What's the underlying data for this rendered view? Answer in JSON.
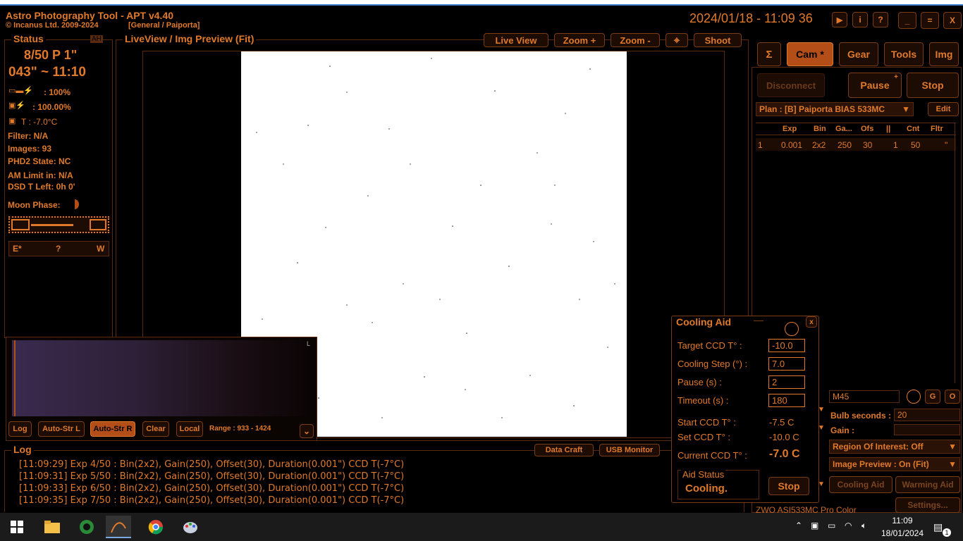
{
  "app": {
    "title": "Astro Photography Tool  -  APT v4.40",
    "copyright": "© Incanus Ltd. 2009-2024",
    "profile": "[General / Paiporta]",
    "datetime": "2024/01/18 - 11:09 36"
  },
  "title_buttons": [
    "▶",
    "i",
    "?",
    "_",
    "=",
    "X"
  ],
  "status": {
    "header": "Status",
    "badge": "AH",
    "line1": "8/50 P   1\"",
    "line2": "043\" ~ 11:10",
    "battery": ": 100%",
    "cam_power": ": 100.00%",
    "temp": "T :  -7.0°C",
    "filter": "Filter: N/A",
    "images": "Images: 93",
    "phd2": "PHD2 State: NC",
    "am_limit": "AM Limit in: N/A",
    "dsd": "DSD T Left: 0h 0'",
    "moon": "Moon Phase:",
    "compass_e": "E*",
    "compass_q": "?",
    "compass_w": "W"
  },
  "liveview": {
    "header": "LiveView / Img Preview (Fit)",
    "buttons": [
      "Live View",
      "Zoom +",
      "Zoom -",
      "⌖",
      "Shoot"
    ]
  },
  "histogram": {
    "corner": "L",
    "buttons": [
      "Log",
      "Auto-Str L",
      "Auto-Str R",
      "Clear",
      "Local"
    ],
    "range": "Range : 933 - 1424"
  },
  "log": {
    "header": "Log",
    "buttons": [
      "Data Craft",
      "USB Monitor"
    ],
    "lines": [
      "[11:09:29] Exp 4/50 : Bin(2x2), Gain(250), Offset(30), Duration(0.001\") CCD T(-7°C)",
      "[11:09:31] Exp 5/50 : Bin(2x2), Gain(250), Offset(30), Duration(0.001\") CCD T(-7°C)",
      "[11:09:33] Exp 6/50 : Bin(2x2), Gain(250), Offset(30), Duration(0.001\") CCD T(-7°C)",
      "[11:09:35] Exp 7/50 : Bin(2x2), Gain(250), Offset(30), Duration(0.001\") CCD T(-7°C)"
    ]
  },
  "tabs": [
    "Σ",
    "Cam *",
    "Gear",
    "Tools",
    "Img"
  ],
  "cam": {
    "disconnect": "Disconnect",
    "pause": "Pause",
    "pause_sup": "+",
    "stop": "Stop",
    "plan": "Plan : [B] Paiporta BIAS 533MC",
    "edit": "Edit",
    "columns": [
      "",
      "Exp",
      "Bin",
      "Ga...",
      "Ofs",
      "||",
      "Cnt",
      "Fltr"
    ],
    "rows": [
      [
        "1",
        "0.001",
        "2x2",
        "250",
        "30",
        "1",
        "50",
        "\""
      ]
    ],
    "object": "M45",
    "g": "G",
    "o": "O",
    "bulb_label": "Bulb seconds :",
    "bulb_val": "20",
    "gain_label": "Gain :",
    "roi": "Region Of Interest: Off",
    "preview": "Image Preview : On (Fit)",
    "cooling_aid": "Cooling Aid",
    "warming_aid": "Warming Aid",
    "settings": "Settings...",
    "camera": "ZWO ASI533MC Pro Color"
  },
  "cooling": {
    "title": "Cooling Aid",
    "close": "x",
    "target_label": "Target CCD T° :",
    "target": "-10.0",
    "step_label": "Cooling Step (°) :",
    "step": "7.0",
    "pause_label": "Pause (s) :",
    "pause": "2",
    "timeout_label": "Timeout (s) :",
    "timeout": "180",
    "start_label": "Start CCD T° :",
    "start": "-7.5 C",
    "set_label": "Set CCD T° :",
    "set": "-10.0 C",
    "current_label": "Current CCD T° :",
    "current": "-7.0 C",
    "aid_status": "Aid Status",
    "status_val": "Cooling.",
    "stop": "Stop"
  },
  "taskbar": {
    "time": "11:09",
    "date": "18/01/2024",
    "notif": "1"
  },
  "colors": {
    "accent": "#e07a2a",
    "panel": "#1c0c04",
    "active": "#b34e18"
  }
}
